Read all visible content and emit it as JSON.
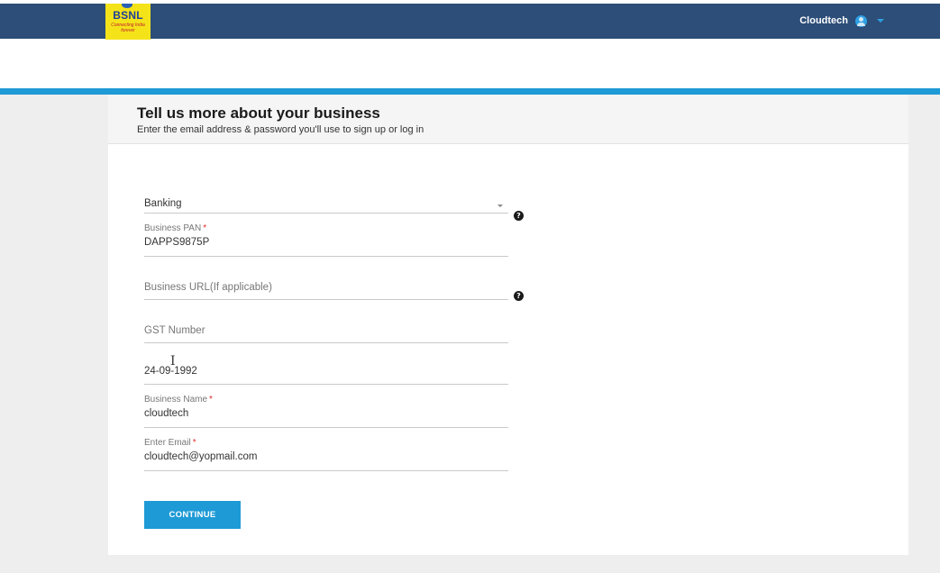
{
  "header": {
    "logo": {
      "title": "BSNL",
      "tagline": "Connecting India forever"
    },
    "user": {
      "name": "Cloudtech"
    }
  },
  "form": {
    "title": "Tell us more about your business",
    "subtitle": "Enter the email address & password you'll use to sign up or log in",
    "category": {
      "value": "Banking"
    },
    "pan": {
      "label": "Business PAN",
      "value": "DAPPS9875P"
    },
    "url": {
      "placeholder": "Business URL(If applicable)"
    },
    "gst": {
      "placeholder": "GST Number"
    },
    "date": {
      "value": "24-09-1992"
    },
    "business_name": {
      "label": "Business Name",
      "value": "cloudtech"
    },
    "email": {
      "label": "Enter Email",
      "value": "cloudtech@yopmail.com"
    },
    "required_marker": "*",
    "help_glyph": "?",
    "continue_label": "CONTINUE"
  },
  "colors": {
    "header_bg": "#2c4e78",
    "accent": "#1e9ad6",
    "logo_bg": "#f5e31a"
  }
}
